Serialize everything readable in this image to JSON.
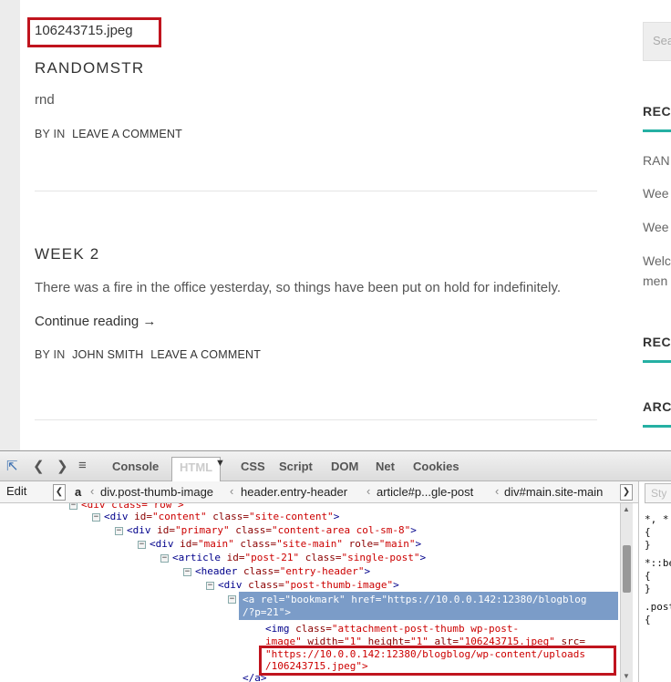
{
  "blog": {
    "filename": "106243715.jpeg",
    "posts": [
      {
        "title": "RANDOMSTR",
        "body": "rnd",
        "meta_by": "BY IN",
        "meta_author": "",
        "meta_comment": "LEAVE A COMMENT"
      },
      {
        "title": "WEEK 2",
        "body": "There was a fire in the office yesterday, so things have been put on hold for indefinitely.",
        "continue": "Continue reading →",
        "meta_by": "BY IN",
        "meta_author": "JOHN SMITH",
        "meta_comment": "LEAVE A COMMENT"
      }
    ]
  },
  "sidebar": {
    "search_placeholder": "Sear",
    "headings": [
      "REC",
      "REC",
      "ARC"
    ],
    "links": [
      "RAN",
      "Wee",
      "Wee",
      "Welc",
      "men"
    ]
  },
  "devtools": {
    "toolbar_tabs": [
      "Console",
      "HTML",
      "CSS",
      "Script",
      "DOM",
      "Net",
      "Cookies"
    ],
    "active_tab": "HTML",
    "edit_label": "Edit",
    "breadcrumbs": [
      "a",
      "div.post-thumb-image",
      "header.entry-header",
      "article#p...gle-post",
      "div#main.site-main"
    ],
    "style_tab": "Sty",
    "tree": {
      "l0": "<div class=\"row\">",
      "l1a": "<div ",
      "l1b": "id=",
      "l1c": "\"content\"",
      "l1d": " class=",
      "l1e": "\"site-content\"",
      "l1f": ">",
      "l2a": "<div ",
      "l2b": "id=",
      "l2c": "\"primary\"",
      "l2d": " class=",
      "l2e": "\"content-area col-sm-8\"",
      "l2f": ">",
      "l3a": "<div ",
      "l3b": "id=",
      "l3c": "\"main\"",
      "l3d": " class=",
      "l3e": "\"site-main\"",
      "l3g": " role=",
      "l3h": "\"main\"",
      "l3f": ">",
      "l4a": "<article ",
      "l4b": "id=",
      "l4c": "\"post-21\"",
      "l4d": " class=",
      "l4e": "\"single-post\"",
      "l4f": ">",
      "l5a": "<header ",
      "l5b": "class=",
      "l5c": "\"entry-header\"",
      "l5f": ">",
      "l6a": "<div ",
      "l6b": "class=",
      "l6c": "\"post-thumb-image\"",
      "l6f": ">",
      "sel1": "<a rel=\"bookmark\" href=\"https://10.0.0.142:12380/blogblog",
      "sel2": "/?p=21\">",
      "img1a": "<img ",
      "img1b": "class=",
      "img1c": "\"attachment-post-thumb wp-post-",
      "img2a": "image\"",
      "img2b": " width=",
      "img2c": "\"1\"",
      "img2d": " height=",
      "img2e": "\"1\"",
      "img2f": " alt=",
      "img2g": "\"106243715.jpeg\"",
      "img2h": " src=",
      "img3": "\"https://10.0.0.142:12380/blogblog/wp-content/uploads",
      "img4": "/106243715.jpeg\">",
      "close": "</a>"
    },
    "side_code": [
      "*, *",
      "{",
      "}",
      "*::be",
      "{",
      "}",
      ".post",
      "{"
    ]
  }
}
